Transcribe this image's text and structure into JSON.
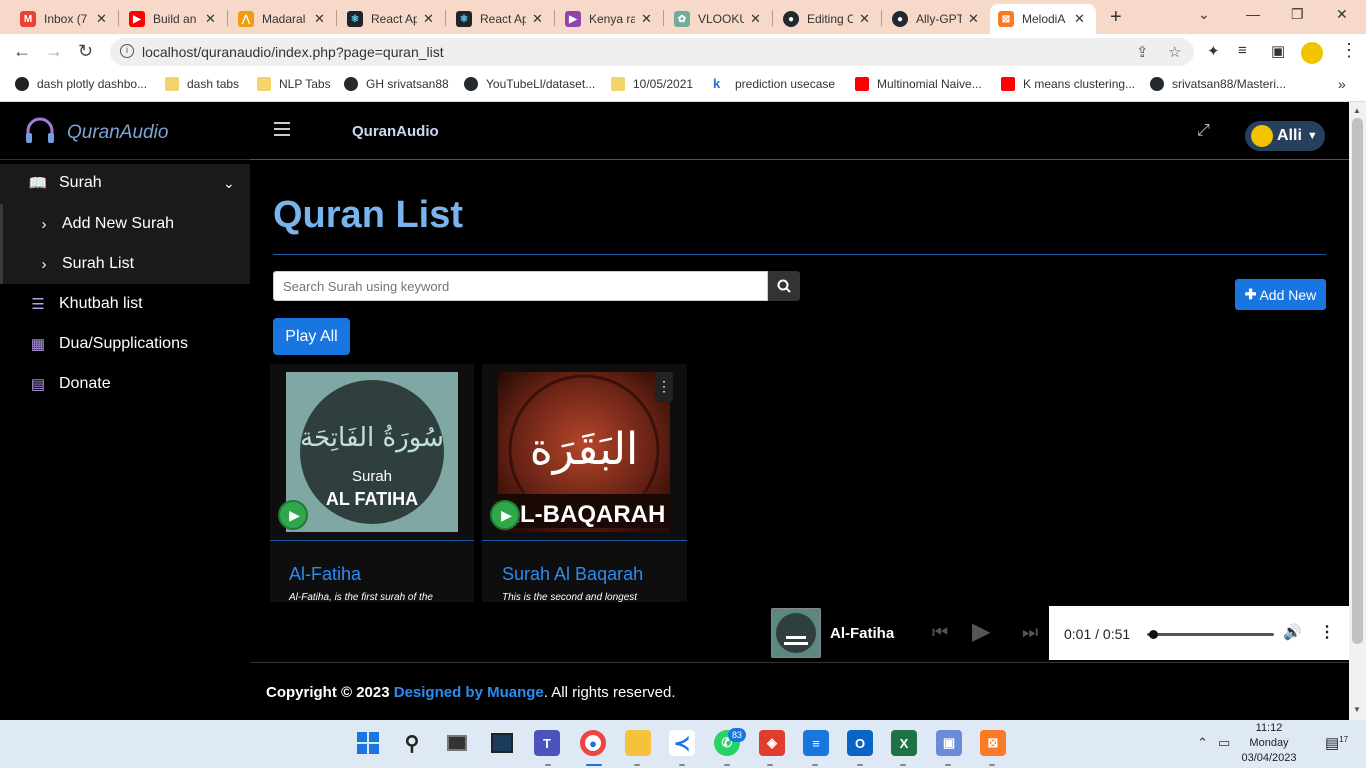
{
  "browser": {
    "tabs": [
      {
        "label": "Inbox (7",
        "icon": "gmail-icon",
        "color": "#ea4335"
      },
      {
        "label": "Build an",
        "icon": "youtube-icon",
        "color": "#ff0000"
      },
      {
        "label": "Madaral",
        "icon": "madaraka-icon",
        "color": "#f39c12"
      },
      {
        "label": "React Ap",
        "icon": "react-icon",
        "color": "#20232a"
      },
      {
        "label": "React Ap",
        "icon": "react-icon",
        "color": "#20232a"
      },
      {
        "label": "Kenya ra",
        "icon": "play-icon",
        "color": "#8e44ad"
      },
      {
        "label": "VLOOKU",
        "icon": "chatgpt-icon",
        "color": "#74aa9c"
      },
      {
        "label": "Editing C",
        "icon": "github-icon",
        "color": "#24292e"
      },
      {
        "label": "Ally-GPT",
        "icon": "github-icon",
        "color": "#24292e"
      },
      {
        "label": "MelodiA",
        "icon": "xampp-icon",
        "color": "#fb7a24"
      }
    ],
    "url": "localhost/quranaudio/index.php?page=quran_list",
    "bookmarks": [
      {
        "label": "dash plotly dashbo...",
        "icon": "bookmark-icon"
      },
      {
        "label": "dash tabs",
        "icon": "folder-icon"
      },
      {
        "label": "NLP Tabs",
        "icon": "folder-icon"
      },
      {
        "label": "GH srivatsan88",
        "icon": "github-icon"
      },
      {
        "label": "YouTubeLl/dataset...",
        "icon": "github-icon"
      },
      {
        "label": "10/05/2021",
        "icon": "folder-icon"
      },
      {
        "label": "prediction usecase",
        "icon": "k-icon"
      },
      {
        "label": "Multinomial Naive...",
        "icon": "youtube-icon"
      },
      {
        "label": "K means clustering...",
        "icon": "youtube-icon"
      },
      {
        "label": "srivatsan88/Masteri...",
        "icon": "github-icon"
      }
    ]
  },
  "app": {
    "brand": "QuranAudio",
    "nav_title": "QuranAudio",
    "user": "Alli",
    "sidebar": {
      "surah": "Surah",
      "add_new_surah": "Add New Surah",
      "surah_list": "Surah List",
      "khutbah": "Khutbah list",
      "dua": "Dua/Supplications",
      "donate": "Donate"
    },
    "page_title": "Quran List",
    "search_placeholder": "Search Surah using keyword",
    "add_new": "Add New",
    "play_all": "Play All",
    "cards": [
      {
        "title": "Al-Fatiha",
        "desc": "Al-Fatiha, is the first surah of the",
        "art_main": "Surah",
        "art_sub": "AL FATIHA",
        "art_arabic": "سُورَةُ الفَاتِحَة"
      },
      {
        "title": "Surah Al Baqarah",
        "desc": "This is the second and longest",
        "art_sub": "AL-BAQARAH",
        "art_arabic": "البَقَرَة"
      }
    ],
    "player": {
      "title": "Al-Fatiha",
      "time": "0:01 / 0:51",
      "progress": 0.02
    },
    "footer": {
      "copyright": "Copyright © 2023 ",
      "link": "Designed by Muange",
      "rest": ". All rights reserved."
    }
  },
  "taskbar": {
    "time": "11:12",
    "day": "Monday",
    "date": "03/04/2023",
    "whatsapp_badge": "83",
    "notif_count": "17"
  }
}
